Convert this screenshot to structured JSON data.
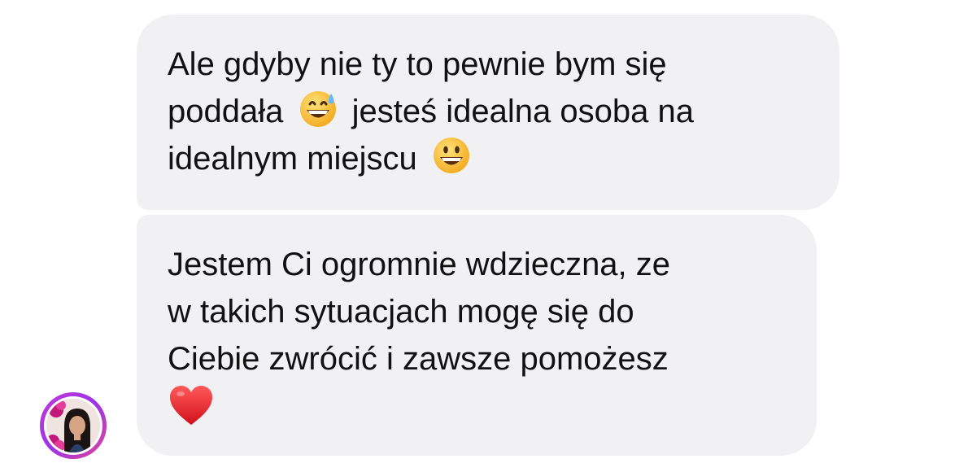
{
  "messages": [
    {
      "lines": [
        {
          "parts": [
            "Ale gdyby nie ty to pewnie bym się"
          ]
        },
        {
          "parts": [
            "poddała",
            "jesteś idealna osoba na"
          ],
          "emoji": "grinning-sweat-emoji"
        },
        {
          "parts": [
            "idealnym miejscu"
          ],
          "emoji": "grinning-emoji"
        }
      ]
    },
    {
      "lines": [
        {
          "parts": [
            "Jestem Ci ogromnie wdzieczna, ze"
          ]
        },
        {
          "parts": [
            "w takich sytuacjach mogę się do"
          ]
        },
        {
          "parts": [
            "Ciebie zwrócić i zawsze pomożesz"
          ]
        }
      ],
      "trailing_emoji": "red-heart-emoji"
    }
  ],
  "avatar": {
    "icon": "user-avatar",
    "ring_colors": [
      "#c13ad6",
      "#9b34e6",
      "#e0459a"
    ]
  },
  "colors": {
    "bubble": "#f1f1f3",
    "text": "#111111"
  }
}
